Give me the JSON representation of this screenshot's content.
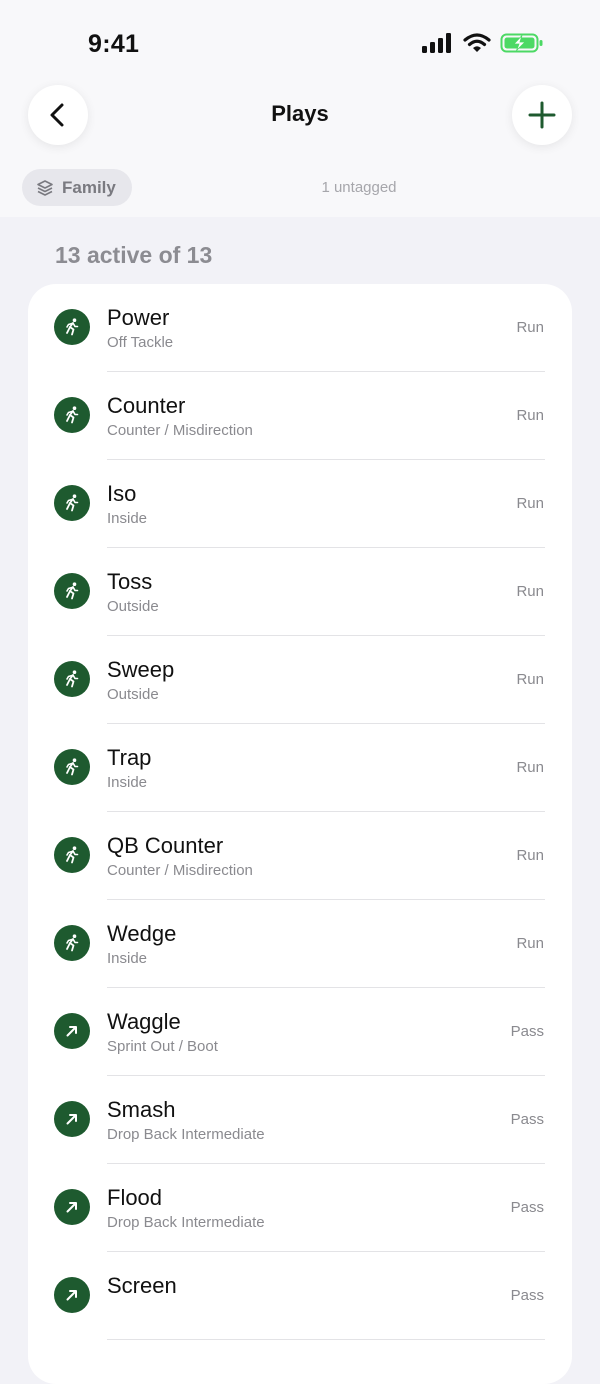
{
  "status_bar": {
    "time": "9:41"
  },
  "nav": {
    "title": "Plays"
  },
  "filter": {
    "chip_label": "Family",
    "untagged_label": "1 untagged"
  },
  "section": {
    "label": "13 active of 13"
  },
  "colors": {
    "accent": "#1e5a2f",
    "background": "#f2f2f7",
    "battery": "#4cd964"
  },
  "plays": [
    {
      "name": "Power",
      "subtitle": "Off Tackle",
      "type": "Run",
      "icon": "running-person-icon"
    },
    {
      "name": "Counter",
      "subtitle": "Counter / Misdirection",
      "type": "Run",
      "icon": "running-person-icon"
    },
    {
      "name": "Iso",
      "subtitle": "Inside",
      "type": "Run",
      "icon": "running-person-icon"
    },
    {
      "name": "Toss",
      "subtitle": "Outside",
      "type": "Run",
      "icon": "running-person-icon"
    },
    {
      "name": "Sweep",
      "subtitle": "Outside",
      "type": "Run",
      "icon": "running-person-icon"
    },
    {
      "name": "Trap",
      "subtitle": "Inside",
      "type": "Run",
      "icon": "running-person-icon"
    },
    {
      "name": "QB Counter",
      "subtitle": "Counter / Misdirection",
      "type": "Run",
      "icon": "running-person-icon"
    },
    {
      "name": "Wedge",
      "subtitle": "Inside",
      "type": "Run",
      "icon": "running-person-icon"
    },
    {
      "name": "Waggle",
      "subtitle": "Sprint Out / Boot",
      "type": "Pass",
      "icon": "arrow-up-right-icon"
    },
    {
      "name": "Smash",
      "subtitle": "Drop Back Intermediate",
      "type": "Pass",
      "icon": "arrow-up-right-icon"
    },
    {
      "name": "Flood",
      "subtitle": "Drop Back Intermediate",
      "type": "Pass",
      "icon": "arrow-up-right-icon"
    },
    {
      "name": "Screen",
      "subtitle": "",
      "type": "Pass",
      "icon": "arrow-up-right-icon"
    }
  ]
}
